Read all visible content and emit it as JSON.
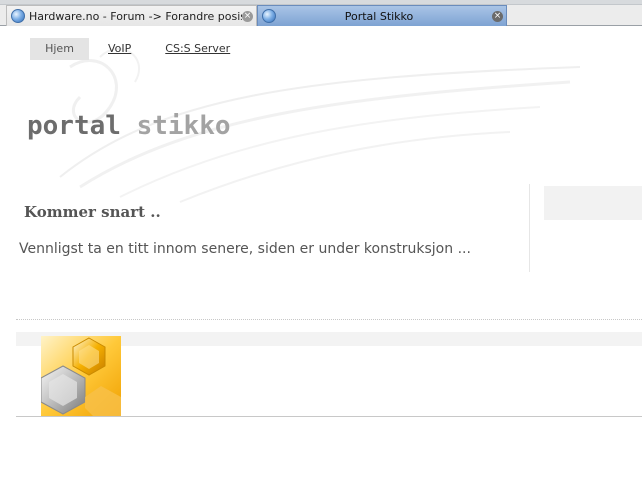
{
  "browser": {
    "tabs": [
      {
        "title": "Hardware.no - Forum -> Forandre posisjo...",
        "active": false,
        "close_glyph": "×"
      },
      {
        "title": "Portal Stikko",
        "active": true,
        "close_glyph": "×"
      }
    ]
  },
  "nav": {
    "items": [
      {
        "label": "Hjem",
        "selected": true
      },
      {
        "label": "VoIP",
        "selected": false
      },
      {
        "label": "CS:S Server",
        "selected": false
      }
    ]
  },
  "logo": {
    "word1": "portal",
    "word2": "stikko"
  },
  "content": {
    "heading": "Kommer snart ..",
    "body": "Vennligst ta en titt innom senere, siden er under konstruksjon ..."
  },
  "colors": {
    "active_tab": "#7ea3d3",
    "logo_dark": "#6d6d6d",
    "logo_light": "#a3a3a3",
    "accent_orange": "#f5a800"
  },
  "icons": {
    "tab_favicon": "globe-icon",
    "tab_close": "close-icon",
    "footer_image": "hexagon-image"
  }
}
